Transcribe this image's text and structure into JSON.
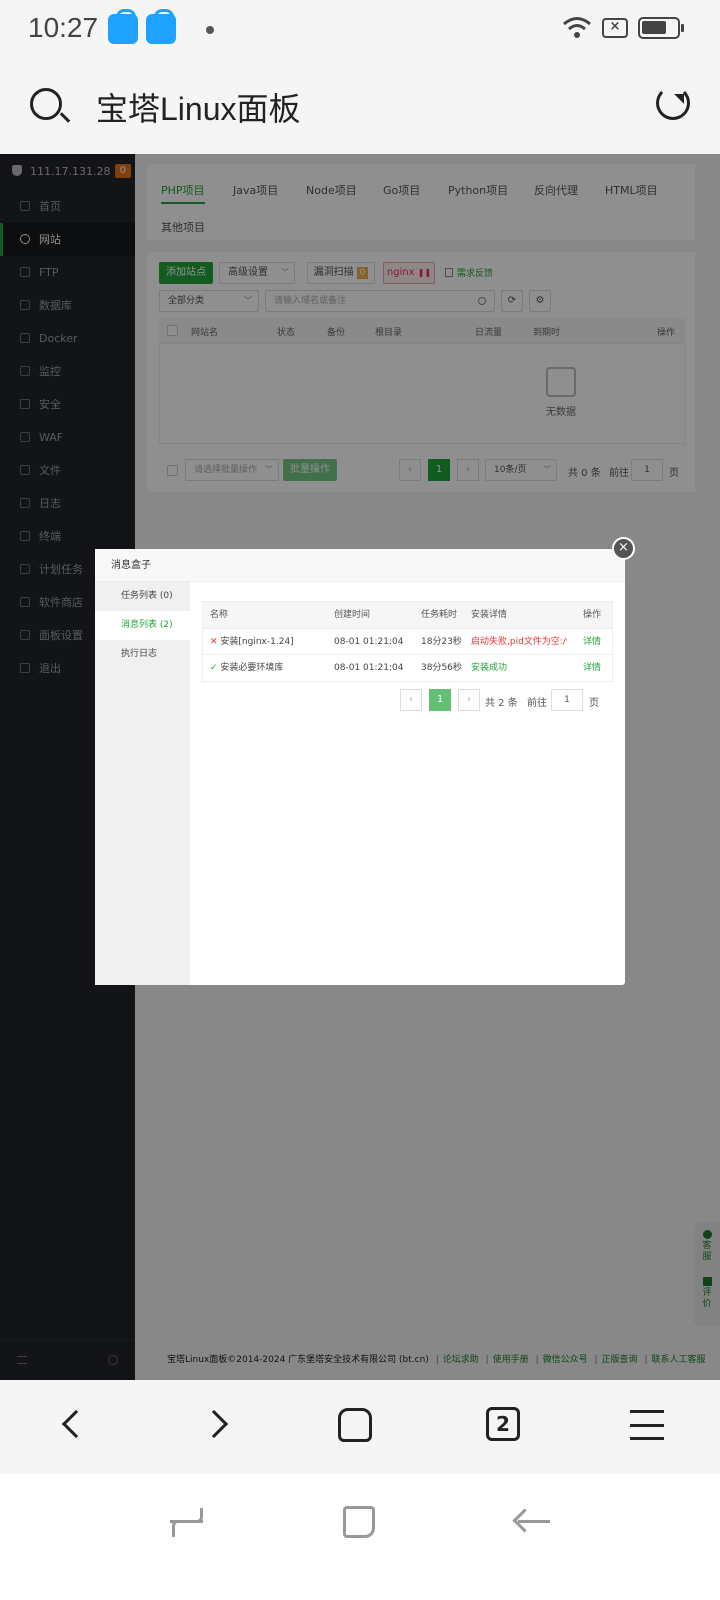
{
  "status_bar": {
    "time": "10:27"
  },
  "address_bar": {
    "title": "宝塔Linux面板"
  },
  "sidebar": {
    "ip": "111.17.131.28",
    "badge": "0",
    "items": [
      "首页",
      "网站",
      "FTP",
      "数据库",
      "Docker",
      "监控",
      "安全",
      "WAF",
      "文件",
      "日志",
      "终端",
      "计划任务",
      "软件商店",
      "面板设置",
      "退出"
    ]
  },
  "tabs": [
    "PHP项目",
    "Java项目",
    "Node项目",
    "Go项目",
    "Python项目",
    "反向代理",
    "HTML项目",
    "其他项目"
  ],
  "toolbar": {
    "add_site": "添加站点",
    "advanced": "高级设置",
    "scan": "漏洞扫描",
    "scan_badge": "0",
    "nginx": "nginx",
    "feedback": "需求反馈",
    "category": "全部分类",
    "search_placeholder": "请输入域名或备注"
  },
  "site_table": {
    "headers": [
      "网站名",
      "状态",
      "备份",
      "根目录",
      "日流量",
      "到期时",
      "操作"
    ],
    "empty_text": "无数据",
    "batch_placeholder": "请选择批量操作",
    "batch_btn": "批量操作",
    "page": "1",
    "page_size": "10条/页",
    "total": "共 0 条",
    "goto": "前往",
    "goto_value": "1",
    "page_unit": "页"
  },
  "modal": {
    "title": "消息盒子",
    "close": "×",
    "side": [
      "任务列表 (0)",
      "消息列表 (2)",
      "执行日志"
    ],
    "headers": [
      "名称",
      "创建时间",
      "任务耗时",
      "安装详情",
      "操作"
    ],
    "rows": [
      {
        "name": "安装[nginx-1.24]",
        "time": "08-01 01:21:04",
        "cost": "18分23秒",
        "detail": "启动失败,pid文件为空:/w",
        "action": "详情"
      },
      {
        "name": "安装必要环境库",
        "time": "08-01 01:21:04",
        "cost": "38分56秒",
        "detail": "安装成功",
        "action": "详情"
      }
    ],
    "pager": {
      "page": "1",
      "total": "共 2 条",
      "goto": "前往",
      "goto_value": "1",
      "page_unit": "页"
    }
  },
  "footer": {
    "copyright": "宝塔Linux面板©2014-2024 广东堡塔安全技术有限公司 (bt.cn)",
    "links": [
      "论坛求助",
      "使用手册",
      "微信公众号",
      "正版查询",
      "联系人工客服"
    ]
  },
  "side_float": [
    "客服",
    "评价"
  ],
  "browser": {
    "tab_count": "2"
  }
}
